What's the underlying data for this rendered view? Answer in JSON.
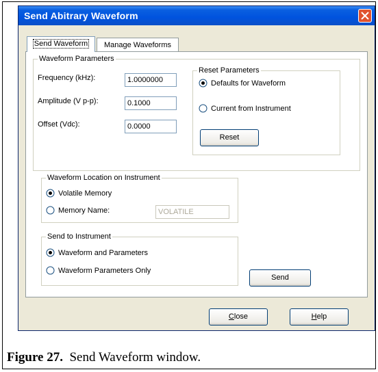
{
  "window": {
    "title": "Send Abitrary Waveform",
    "close_icon": "close-x-icon"
  },
  "tabs": [
    {
      "label": "Send Waveform",
      "active": true
    },
    {
      "label": "Manage Waveforms",
      "active": false
    }
  ],
  "waveform_parameters": {
    "legend": "Waveform Parameters",
    "frequency": {
      "label": "Frequency (kHz):",
      "value": "1.0000000"
    },
    "amplitude": {
      "label": "Amplitude (V p-p):",
      "value": "0.1000"
    },
    "offset": {
      "label": "Offset (Vdc):",
      "value": "0.0000"
    }
  },
  "reset_parameters": {
    "legend": "Reset Parameters",
    "options": [
      {
        "label": "Defaults for Waveform",
        "selected": true
      },
      {
        "label": "Current from Instrument",
        "selected": false
      }
    ],
    "reset_label": "Reset"
  },
  "waveform_location": {
    "legend": "Waveform Location on Instrument",
    "options": [
      {
        "label": "Volatile Memory",
        "selected": true
      },
      {
        "label": "Memory Name:",
        "selected": false
      }
    ],
    "memory_name_value": "VOLATILE"
  },
  "send_to_instrument": {
    "legend": "Send to Instrument",
    "options": [
      {
        "label": "Waveform and Parameters",
        "selected": true
      },
      {
        "label": "Waveform Parameters Only",
        "selected": false
      }
    ],
    "send_label": "Send"
  },
  "footer": {
    "close_mnemonic": "C",
    "close_rest": "lose",
    "help_mnemonic": "H",
    "help_rest": "elp"
  },
  "caption": {
    "label": "Figure 27.",
    "text": "Send Waveform window."
  }
}
